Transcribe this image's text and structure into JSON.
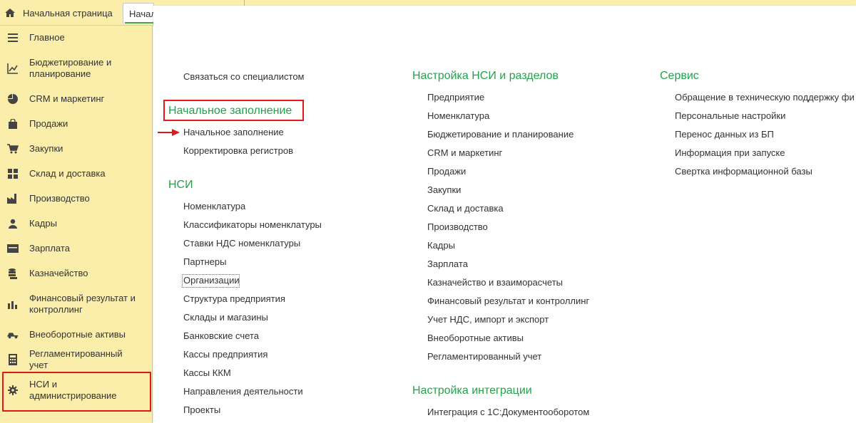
{
  "tabs": {
    "home_label": "Начальная страница",
    "active_label": "Начальное заполнение"
  },
  "sidebar": {
    "items": [
      {
        "label": "Главное",
        "icon": "menu-icon"
      },
      {
        "label": "Бюджетирование и планирование",
        "icon": "budget-chart-icon"
      },
      {
        "label": "CRM и маркетинг",
        "icon": "pie-chart-icon"
      },
      {
        "label": "Продажи",
        "icon": "shopping-bag-icon"
      },
      {
        "label": "Закупки",
        "icon": "cart-icon"
      },
      {
        "label": "Склад и доставка",
        "icon": "warehouse-grid-icon"
      },
      {
        "label": "Производство",
        "icon": "factory-icon"
      },
      {
        "label": "Кадры",
        "icon": "person-icon"
      },
      {
        "label": "Зарплата",
        "icon": "wallet-icon"
      },
      {
        "label": "Казначейство",
        "icon": "coins-icon"
      },
      {
        "label": "Финансовый результат и контроллинг",
        "icon": "bar-chart-icon"
      },
      {
        "label": "Внеоборотные активы",
        "icon": "truck-icon"
      },
      {
        "label": "Регламентированный учет",
        "icon": "calculator-icon"
      },
      {
        "label": "НСИ и администрирование",
        "icon": "gear-icon"
      }
    ]
  },
  "col1": {
    "contact": "Связаться со специалистом",
    "initial_header": "Начальное заполнение",
    "initial_items": [
      "Начальное заполнение",
      "Корректировка регистров"
    ],
    "nsi_header": "НСИ",
    "nsi_items": [
      "Номенклатура",
      "Классификаторы номенклатуры",
      "Ставки НДС номенклатуры",
      "Партнеры",
      "Организации",
      "Структура предприятия",
      "Склады и магазины",
      "Банковские счета",
      "Кассы предприятия",
      "Кассы ККМ",
      "Направления деятельности",
      "Проекты"
    ]
  },
  "col2": {
    "setup_header": "Настройка НСИ и разделов",
    "setup_items": [
      "Предприятие",
      "Номенклатура",
      "Бюджетирование и планирование",
      "CRM и маркетинг",
      "Продажи",
      "Закупки",
      "Склад и доставка",
      "Производство",
      "Кадры",
      "Зарплата",
      "Казначейство и взаиморасчеты",
      "Финансовый результат и контроллинг",
      "Учет НДС, импорт и экспорт",
      "Внеоборотные активы",
      "Регламентированный учет"
    ],
    "integration_header": "Настройка интеграции",
    "integration_items": [
      "Интеграция с 1С:Документооборотом"
    ]
  },
  "col3": {
    "service_header": "Сервис",
    "service_items": [
      "Обращение в техническую поддержку фи",
      "Персональные настройки",
      "Перенос данных из БП",
      "Информация при запуске",
      "Свертка информационной базы"
    ]
  },
  "colors": {
    "sidebar_bg": "#fbeeab",
    "header_green": "#24a24b",
    "highlight_red": "#e01818"
  }
}
